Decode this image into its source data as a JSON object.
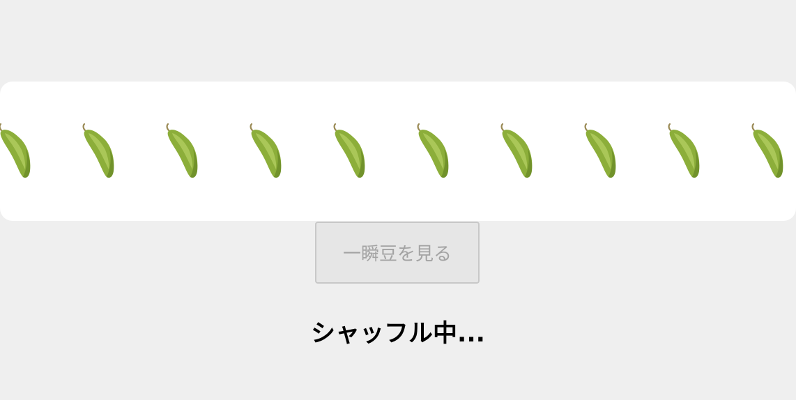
{
  "pods": {
    "icon": "edamame-pod-icon",
    "count": 10,
    "colors": {
      "pod_fill": "#8cae3a",
      "pod_highlight": "#b4cf63",
      "pod_shadow": "#5f7f22",
      "stem": "#9a8a55"
    }
  },
  "button": {
    "label": "一瞬豆を見る",
    "disabled": true
  },
  "status": {
    "text": "シャッフル中..."
  }
}
